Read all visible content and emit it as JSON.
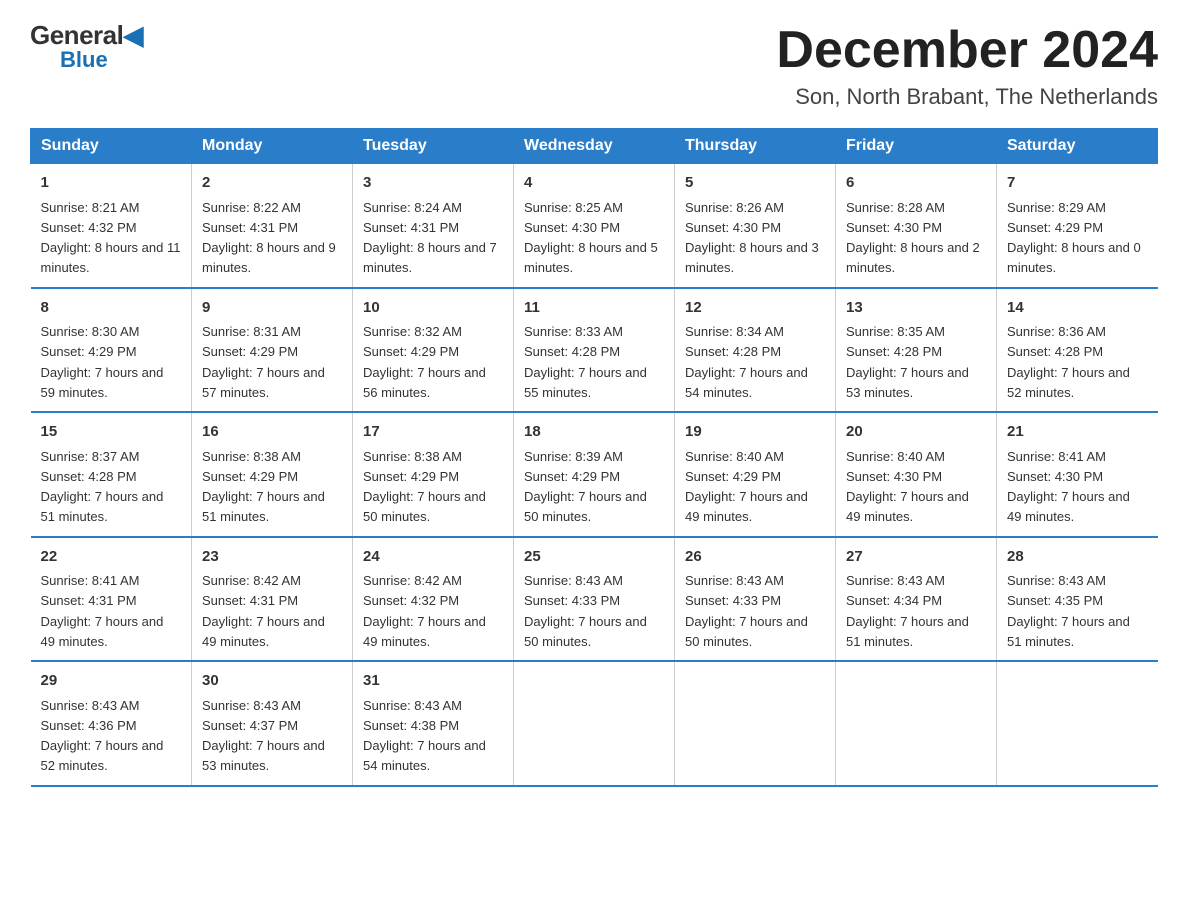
{
  "header": {
    "logo_general": "General",
    "logo_blue": "Blue",
    "month_title": "December 2024",
    "subtitle": "Son, North Brabant, The Netherlands"
  },
  "weekdays": [
    "Sunday",
    "Monday",
    "Tuesday",
    "Wednesday",
    "Thursday",
    "Friday",
    "Saturday"
  ],
  "weeks": [
    [
      {
        "day": "1",
        "sunrise": "8:21 AM",
        "sunset": "4:32 PM",
        "daylight": "8 hours and 11 minutes."
      },
      {
        "day": "2",
        "sunrise": "8:22 AM",
        "sunset": "4:31 PM",
        "daylight": "8 hours and 9 minutes."
      },
      {
        "day": "3",
        "sunrise": "8:24 AM",
        "sunset": "4:31 PM",
        "daylight": "8 hours and 7 minutes."
      },
      {
        "day": "4",
        "sunrise": "8:25 AM",
        "sunset": "4:30 PM",
        "daylight": "8 hours and 5 minutes."
      },
      {
        "day": "5",
        "sunrise": "8:26 AM",
        "sunset": "4:30 PM",
        "daylight": "8 hours and 3 minutes."
      },
      {
        "day": "6",
        "sunrise": "8:28 AM",
        "sunset": "4:30 PM",
        "daylight": "8 hours and 2 minutes."
      },
      {
        "day": "7",
        "sunrise": "8:29 AM",
        "sunset": "4:29 PM",
        "daylight": "8 hours and 0 minutes."
      }
    ],
    [
      {
        "day": "8",
        "sunrise": "8:30 AM",
        "sunset": "4:29 PM",
        "daylight": "7 hours and 59 minutes."
      },
      {
        "day": "9",
        "sunrise": "8:31 AM",
        "sunset": "4:29 PM",
        "daylight": "7 hours and 57 minutes."
      },
      {
        "day": "10",
        "sunrise": "8:32 AM",
        "sunset": "4:29 PM",
        "daylight": "7 hours and 56 minutes."
      },
      {
        "day": "11",
        "sunrise": "8:33 AM",
        "sunset": "4:28 PM",
        "daylight": "7 hours and 55 minutes."
      },
      {
        "day": "12",
        "sunrise": "8:34 AM",
        "sunset": "4:28 PM",
        "daylight": "7 hours and 54 minutes."
      },
      {
        "day": "13",
        "sunrise": "8:35 AM",
        "sunset": "4:28 PM",
        "daylight": "7 hours and 53 minutes."
      },
      {
        "day": "14",
        "sunrise": "8:36 AM",
        "sunset": "4:28 PM",
        "daylight": "7 hours and 52 minutes."
      }
    ],
    [
      {
        "day": "15",
        "sunrise": "8:37 AM",
        "sunset": "4:28 PM",
        "daylight": "7 hours and 51 minutes."
      },
      {
        "day": "16",
        "sunrise": "8:38 AM",
        "sunset": "4:29 PM",
        "daylight": "7 hours and 51 minutes."
      },
      {
        "day": "17",
        "sunrise": "8:38 AM",
        "sunset": "4:29 PM",
        "daylight": "7 hours and 50 minutes."
      },
      {
        "day": "18",
        "sunrise": "8:39 AM",
        "sunset": "4:29 PM",
        "daylight": "7 hours and 50 minutes."
      },
      {
        "day": "19",
        "sunrise": "8:40 AM",
        "sunset": "4:29 PM",
        "daylight": "7 hours and 49 minutes."
      },
      {
        "day": "20",
        "sunrise": "8:40 AM",
        "sunset": "4:30 PM",
        "daylight": "7 hours and 49 minutes."
      },
      {
        "day": "21",
        "sunrise": "8:41 AM",
        "sunset": "4:30 PM",
        "daylight": "7 hours and 49 minutes."
      }
    ],
    [
      {
        "day": "22",
        "sunrise": "8:41 AM",
        "sunset": "4:31 PM",
        "daylight": "7 hours and 49 minutes."
      },
      {
        "day": "23",
        "sunrise": "8:42 AM",
        "sunset": "4:31 PM",
        "daylight": "7 hours and 49 minutes."
      },
      {
        "day": "24",
        "sunrise": "8:42 AM",
        "sunset": "4:32 PM",
        "daylight": "7 hours and 49 minutes."
      },
      {
        "day": "25",
        "sunrise": "8:43 AM",
        "sunset": "4:33 PM",
        "daylight": "7 hours and 50 minutes."
      },
      {
        "day": "26",
        "sunrise": "8:43 AM",
        "sunset": "4:33 PM",
        "daylight": "7 hours and 50 minutes."
      },
      {
        "day": "27",
        "sunrise": "8:43 AM",
        "sunset": "4:34 PM",
        "daylight": "7 hours and 51 minutes."
      },
      {
        "day": "28",
        "sunrise": "8:43 AM",
        "sunset": "4:35 PM",
        "daylight": "7 hours and 51 minutes."
      }
    ],
    [
      {
        "day": "29",
        "sunrise": "8:43 AM",
        "sunset": "4:36 PM",
        "daylight": "7 hours and 52 minutes."
      },
      {
        "day": "30",
        "sunrise": "8:43 AM",
        "sunset": "4:37 PM",
        "daylight": "7 hours and 53 minutes."
      },
      {
        "day": "31",
        "sunrise": "8:43 AM",
        "sunset": "4:38 PM",
        "daylight": "7 hours and 54 minutes."
      },
      null,
      null,
      null,
      null
    ]
  ],
  "labels": {
    "sunrise_prefix": "Sunrise: ",
    "sunset_prefix": "Sunset: ",
    "daylight_prefix": "Daylight: "
  }
}
